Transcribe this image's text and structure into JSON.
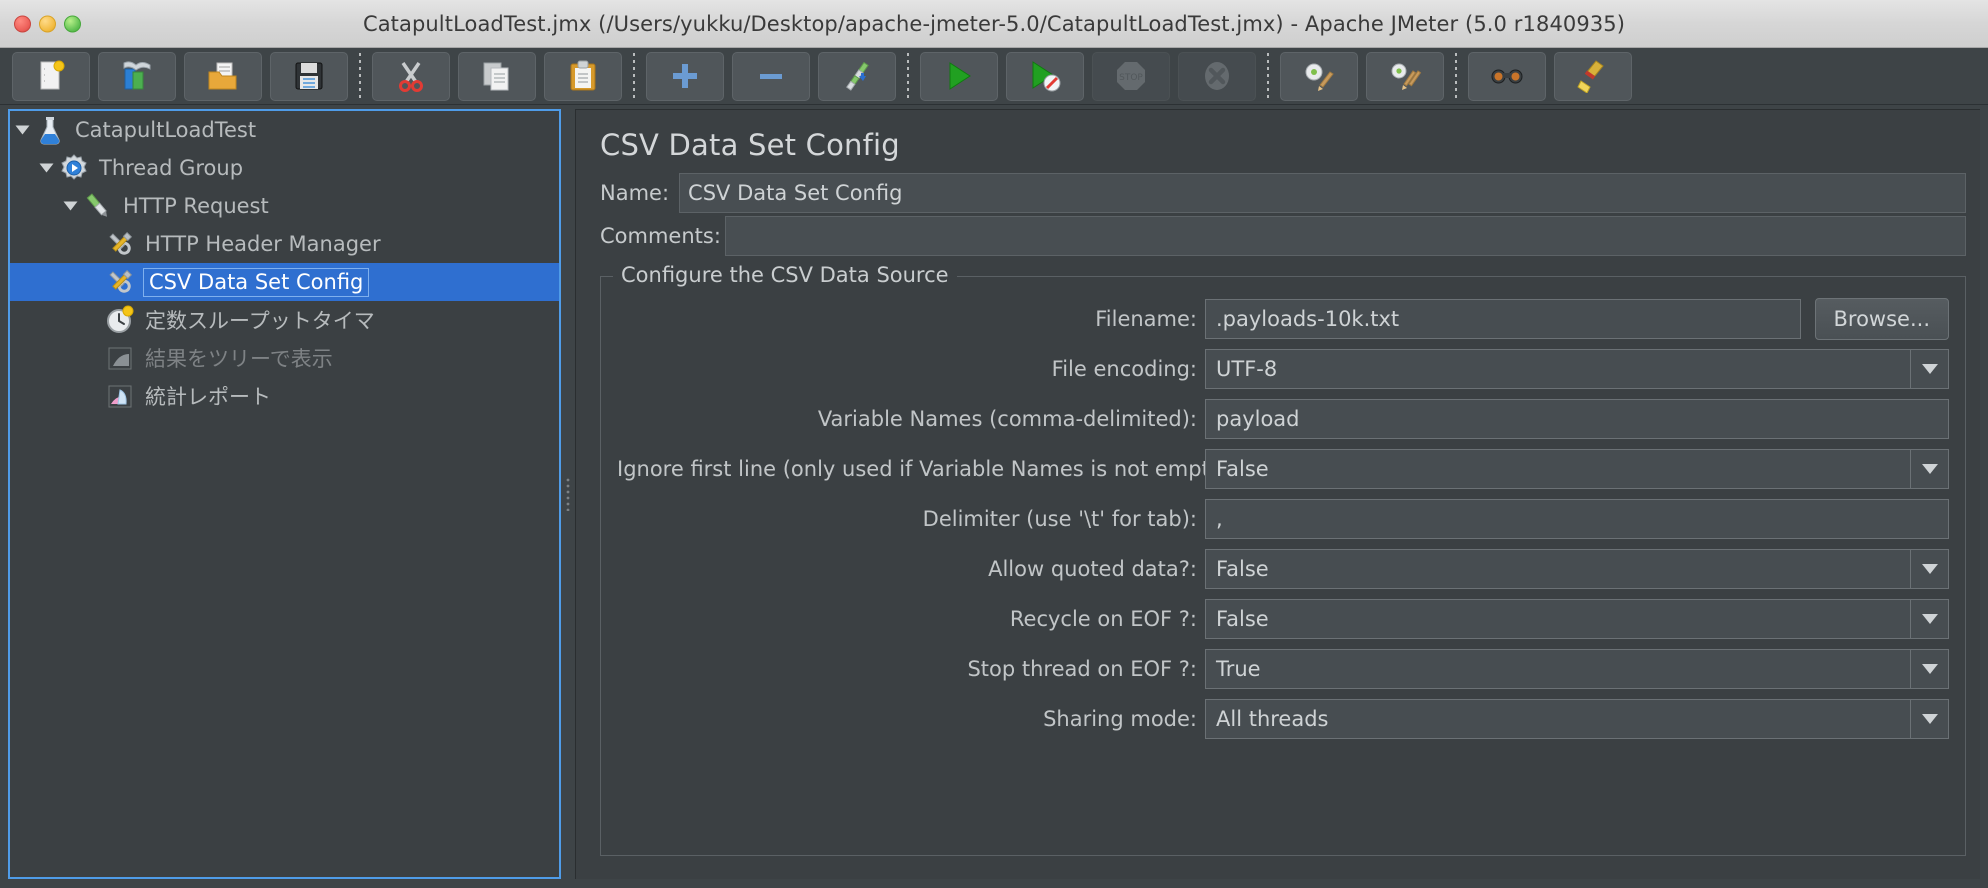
{
  "window": {
    "title": "CatapultLoadTest.jmx (/Users/yukku/Desktop/apache-jmeter-5.0/CatapultLoadTest.jmx) - Apache JMeter (5.0 r1840935)"
  },
  "toolbar": {
    "buttons": [
      {
        "name": "new-icon",
        "title": "New"
      },
      {
        "name": "templates-icon",
        "title": "Templates"
      },
      {
        "name": "open-icon",
        "title": "Open"
      },
      {
        "name": "save-icon",
        "title": "Save"
      },
      {
        "name": "cut-icon",
        "title": "Cut"
      },
      {
        "name": "copy-icon",
        "title": "Copy"
      },
      {
        "name": "paste-icon",
        "title": "Paste"
      },
      {
        "name": "expand-all-icon",
        "title": "Expand All"
      },
      {
        "name": "collapse-all-icon",
        "title": "Collapse All"
      },
      {
        "name": "toggle-icon",
        "title": "Toggle"
      },
      {
        "name": "start-icon",
        "title": "Start"
      },
      {
        "name": "start-no-pauses-icon",
        "title": "Start no pauses"
      },
      {
        "name": "stop-icon",
        "title": "Stop"
      },
      {
        "name": "shutdown-icon",
        "title": "Shutdown"
      },
      {
        "name": "clear-icon",
        "title": "Clear"
      },
      {
        "name": "clear-all-icon",
        "title": "Clear All"
      },
      {
        "name": "search-icon",
        "title": "Search"
      },
      {
        "name": "reset-search-icon",
        "title": "Reset Search"
      }
    ]
  },
  "tree": {
    "items": [
      {
        "label": "CatapultLoadTest",
        "icon": "test-plan-icon",
        "depth": 0,
        "expanded": true,
        "selected": false,
        "disabled": false
      },
      {
        "label": "Thread Group",
        "icon": "thread-group-icon",
        "depth": 1,
        "expanded": true,
        "selected": false,
        "disabled": false
      },
      {
        "label": "HTTP Request",
        "icon": "http-request-icon",
        "depth": 2,
        "expanded": true,
        "selected": false,
        "disabled": false
      },
      {
        "label": "HTTP Header Manager",
        "icon": "config-element-icon",
        "depth": 3,
        "expanded": null,
        "selected": false,
        "disabled": false
      },
      {
        "label": "CSV Data Set Config",
        "icon": "config-element-icon",
        "depth": 3,
        "expanded": null,
        "selected": true,
        "disabled": false
      },
      {
        "label": "定数スループットタイマ",
        "icon": "timer-icon",
        "depth": 3,
        "expanded": null,
        "selected": false,
        "disabled": false
      },
      {
        "label": "結果をツリーで表示",
        "icon": "view-results-tree-icon",
        "depth": 3,
        "expanded": null,
        "selected": false,
        "disabled": true
      },
      {
        "label": "統計レポート",
        "icon": "summary-report-icon",
        "depth": 3,
        "expanded": null,
        "selected": false,
        "disabled": false
      }
    ]
  },
  "config": {
    "page_title": "CSV Data Set Config",
    "name_label": "Name:",
    "name_value": "CSV Data Set Config",
    "comments_label": "Comments:",
    "comments_value": "",
    "group_legend": "Configure the CSV Data Source",
    "browse_label": "Browse...",
    "fields": [
      {
        "label": "Filename:",
        "value": ".payloads-10k.txt",
        "type": "text",
        "has_browse": true
      },
      {
        "label": "File encoding:",
        "value": "UTF-8",
        "type": "combo",
        "has_browse": false
      },
      {
        "label": "Variable Names (comma-delimited):",
        "value": "payload",
        "type": "text",
        "has_browse": false
      },
      {
        "label": "Ignore first line (only used if Variable Names is not empty):",
        "value": "False",
        "type": "combo",
        "has_browse": false
      },
      {
        "label": "Delimiter (use '\\t' for tab):",
        "value": ",",
        "type": "text",
        "has_browse": false
      },
      {
        "label": "Allow quoted data?:",
        "value": "False",
        "type": "combo",
        "has_browse": false
      },
      {
        "label": "Recycle on EOF ?:",
        "value": "False",
        "type": "combo",
        "has_browse": false
      },
      {
        "label": "Stop thread on EOF ?:",
        "value": "True",
        "type": "combo",
        "has_browse": false
      },
      {
        "label": "Sharing mode:",
        "value": "All threads",
        "type": "combo",
        "has_browse": false
      }
    ]
  },
  "colors": {
    "selection": "#2f6fd0",
    "panel_bg": "#3b4043",
    "app_bg": "#3e4447",
    "focus_border": "#4f9ce8",
    "text": "#c6cacc"
  }
}
